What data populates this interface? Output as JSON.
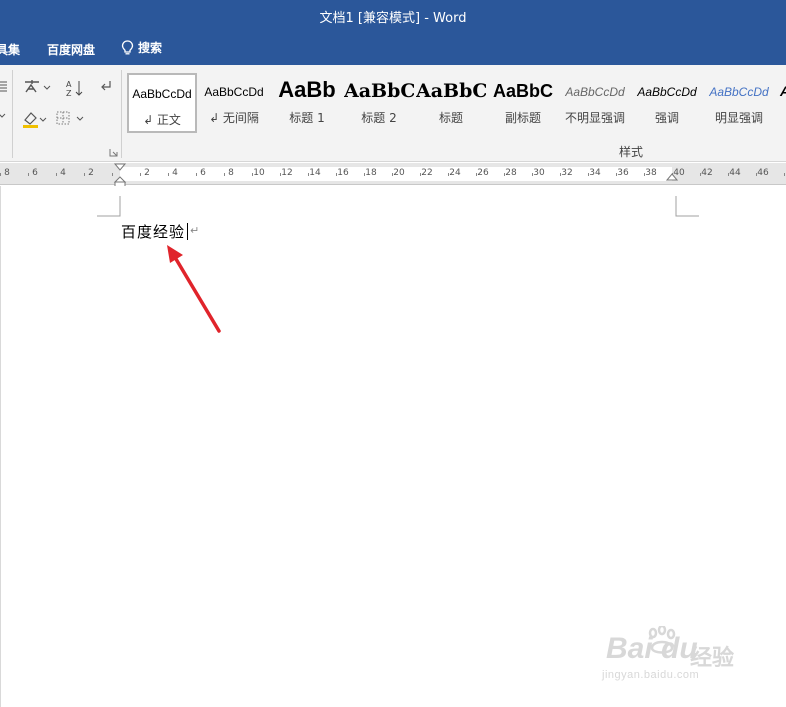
{
  "window": {
    "title": "文档1 [兼容模式]  -  Word"
  },
  "menu": {
    "tools": "具集",
    "netdisk": "百度网盘",
    "search": "搜索"
  },
  "styles": {
    "group_label": "样式",
    "items": [
      {
        "sample": "AaBbCcDd",
        "name": "↲ 正文",
        "selected": true
      },
      {
        "sample": "AaBbCcDd",
        "name": "↲ 无间隔"
      },
      {
        "sample": "AaBb",
        "name": "标题 1"
      },
      {
        "sample": "AaBbC",
        "name": "标题 2"
      },
      {
        "sample": "AaBbC",
        "name": "标题"
      },
      {
        "sample": "AaBbC",
        "name": "副标题"
      },
      {
        "sample": "AaBbCcDd",
        "name": "不明显强调"
      },
      {
        "sample": "AaBbCcDd",
        "name": "强调"
      },
      {
        "sample": "AaBbCcDd",
        "name": "明显强调"
      }
    ]
  },
  "ruler": {
    "left_numbers": [
      "8",
      "6",
      "4",
      "2"
    ],
    "right_numbers": [
      "2",
      "4",
      "6",
      "8",
      "10",
      "12",
      "14",
      "16",
      "18",
      "20",
      "22",
      "24",
      "26",
      "28",
      "30",
      "32",
      "34",
      "36",
      "38",
      "40",
      "42",
      "44",
      "46"
    ]
  },
  "document": {
    "text": "百度经验"
  },
  "watermark": {
    "brand": "Bai du",
    "cn": "经验",
    "url": "jingyan.baidu.com"
  },
  "colors": {
    "title_bar": "#2b579a",
    "arrow": "#e0242b"
  }
}
